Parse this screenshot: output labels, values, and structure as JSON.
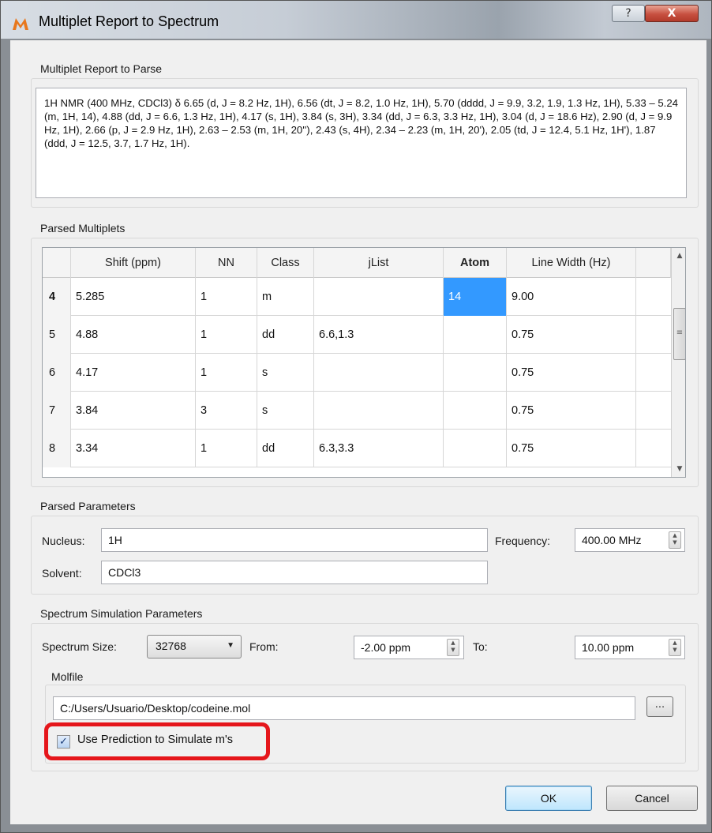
{
  "window": {
    "title": "Multiplet Report to Spectrum",
    "help_label": "?",
    "close_label": "X"
  },
  "report": {
    "group_title": "Multiplet Report to Parse",
    "text": "1H NMR (400 MHz, CDCl3) δ 6.65 (d, J = 8.2 Hz, 1H), 6.56 (dt, J = 8.2, 1.0 Hz, 1H), 5.70 (dddd, J = 9.9, 3.2, 1.9, 1.3 Hz, 1H), 5.33 – 5.24 (m, 1H, 14), 4.88 (dd, J = 6.6, 1.3 Hz, 1H), 4.17 (s, 1H), 3.84 (s, 3H), 3.34 (dd, J = 6.3, 3.3 Hz, 1H), 3.04 (d, J = 18.6 Hz), 2.90 (d, J = 9.9 Hz, 1H), 2.66 (p, J = 2.9 Hz, 1H), 2.63 – 2.53 (m, 1H, 20''), 2.43 (s, 4H), 2.34 – 2.23 (m, 1H, 20'), 2.05 (td, J = 12.4, 5.1 Hz, 1H'), 1.87 (ddd, J = 12.5, 3.7, 1.7 Hz, 1H)."
  },
  "multiplets": {
    "group_title": "Parsed Multiplets",
    "columns": [
      "Shift (ppm)",
      "NN",
      "Class",
      "jList",
      "Atom",
      "Line Width (Hz)"
    ],
    "rows": [
      {
        "num": "4",
        "shift": "5.285",
        "nn": "1",
        "cls": "m",
        "jlist": "",
        "atom": "14",
        "width": "9.00"
      },
      {
        "num": "5",
        "shift": "4.88",
        "nn": "1",
        "cls": "dd",
        "jlist": "6.6,1.3",
        "atom": "",
        "width": "0.75"
      },
      {
        "num": "6",
        "shift": "4.17",
        "nn": "1",
        "cls": "s",
        "jlist": "",
        "atom": "",
        "width": "0.75"
      },
      {
        "num": "7",
        "shift": "3.84",
        "nn": "3",
        "cls": "s",
        "jlist": "",
        "atom": "",
        "width": "0.75"
      },
      {
        "num": "8",
        "shift": "3.34",
        "nn": "1",
        "cls": "dd",
        "jlist": "6.3,3.3",
        "atom": "",
        "width": "0.75"
      }
    ]
  },
  "parameters": {
    "group_title": "Parsed Parameters",
    "nucleus_label": "Nucleus:",
    "nucleus_value": "1H",
    "frequency_label": "Frequency:",
    "frequency_value": "400.00 MHz",
    "solvent_label": "Solvent:",
    "solvent_value": "CDCl3"
  },
  "simulation": {
    "group_title": "Spectrum Simulation Parameters",
    "size_label": "Spectrum Size:",
    "size_value": "32768",
    "from_label": "From:",
    "from_value": "-2.00 ppm",
    "to_label": "To:",
    "to_value": "10.00 ppm",
    "molfile_title": "Molfile",
    "molfile_path": "C:/Users/Usuario/Desktop/codeine.mol",
    "browse_label": "...",
    "prediction_label": "Use Prediction to Simulate m's",
    "prediction_checked": true
  },
  "buttons": {
    "ok": "OK",
    "cancel": "Cancel"
  },
  "colors": {
    "selection": "#3399ff",
    "highlight": "#e5161b"
  }
}
